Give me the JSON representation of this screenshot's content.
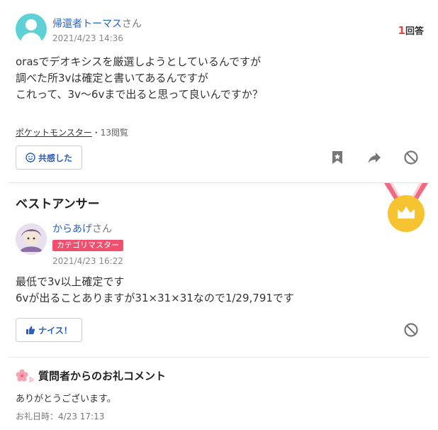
{
  "question": {
    "user_name": "帰還者トーマス",
    "user_suffix": "さん",
    "date": "2021/4/23 14:36",
    "answer_count": "1",
    "answer_count_label": "回答",
    "body_lines": [
      "orasでデオキシスを厳選しようとしているんですが",
      "調べた所3vは確定と書いてあるんですが",
      "これって、3v〜6vまで出ると思って良いんですか？"
    ],
    "category": "ポケットモンスター",
    "views": "・13閲覧",
    "empathy_label": "共感した"
  },
  "best_answer": {
    "section_title": "ベストアンサー",
    "user_name": "からあげ",
    "user_suffix": "さん",
    "badge": "カテゴリマスター",
    "date": "2021/4/23 16:22",
    "body_lines": [
      "最低で3v以上確定です",
      "6vが出ることありますが31×31×31なので1/29,791です"
    ],
    "nice_label": "ナイス！"
  },
  "thanks": {
    "title": "質問者からのお礼コメント",
    "body": "ありがとうございます。",
    "date": "お礼日時：4/23 17:13"
  },
  "colors": {
    "link": "#2563c9",
    "accent_red": "#e54747",
    "badge": "#f0506e",
    "medal_gold": "#f5c430",
    "medal_ribbon": "#f06a7f"
  },
  "icons": [
    "person-avatar-icon",
    "smile-icon",
    "bookmark-star-icon",
    "share-arrow-icon",
    "block-icon",
    "crown-medal-icon",
    "thumbs-up-icon",
    "flower-icon"
  ]
}
